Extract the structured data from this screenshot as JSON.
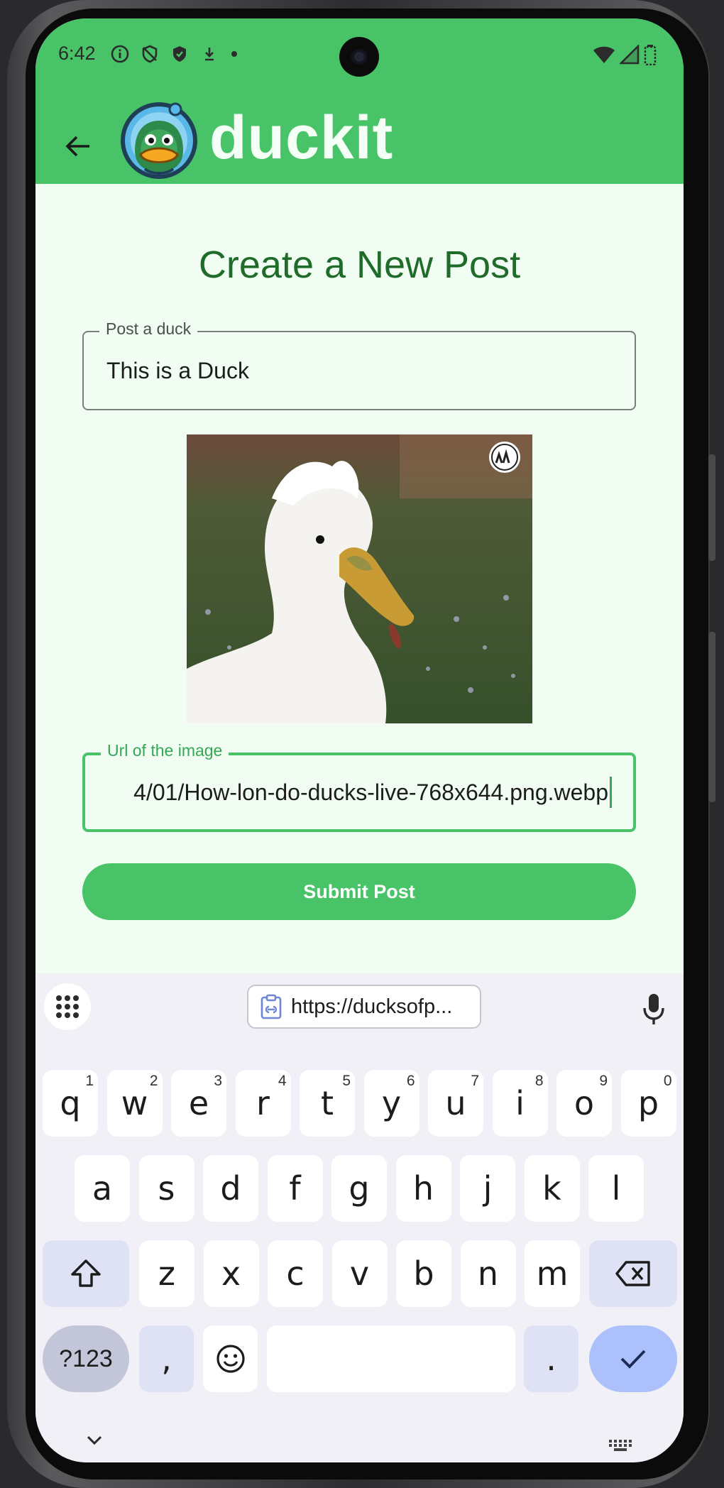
{
  "status_bar": {
    "time": "6:42"
  },
  "app_bar": {
    "title": "duckit",
    "back_icon": "arrow-back-icon",
    "logo": "duck-logo"
  },
  "form": {
    "heading": "Create a New Post",
    "title_field": {
      "label": "Post a duck",
      "value": "This is a Duck"
    },
    "url_field": {
      "label": "Url of the image",
      "value": "4/01/How-lon-do-ducks-live-768x644.png.webp"
    },
    "submit_label": "Submit Post"
  },
  "keyboard": {
    "clipboard_suggestion": "https://ducksofp...",
    "row1": [
      {
        "key": "q",
        "hint": "1"
      },
      {
        "key": "w",
        "hint": "2"
      },
      {
        "key": "e",
        "hint": "3"
      },
      {
        "key": "r",
        "hint": "4"
      },
      {
        "key": "t",
        "hint": "5"
      },
      {
        "key": "y",
        "hint": "6"
      },
      {
        "key": "u",
        "hint": "7"
      },
      {
        "key": "i",
        "hint": "8"
      },
      {
        "key": "o",
        "hint": "9"
      },
      {
        "key": "p",
        "hint": "0"
      }
    ],
    "row2": [
      "a",
      "s",
      "d",
      "f",
      "g",
      "h",
      "j",
      "k",
      "l"
    ],
    "row3": [
      "z",
      "x",
      "c",
      "v",
      "b",
      "n",
      "m"
    ],
    "symbols_label": "?123",
    "comma": ",",
    "period": "."
  },
  "colors": {
    "brand_green": "#48c368",
    "heading_green": "#1e6b2a",
    "content_bg": "#f1fdf3"
  }
}
